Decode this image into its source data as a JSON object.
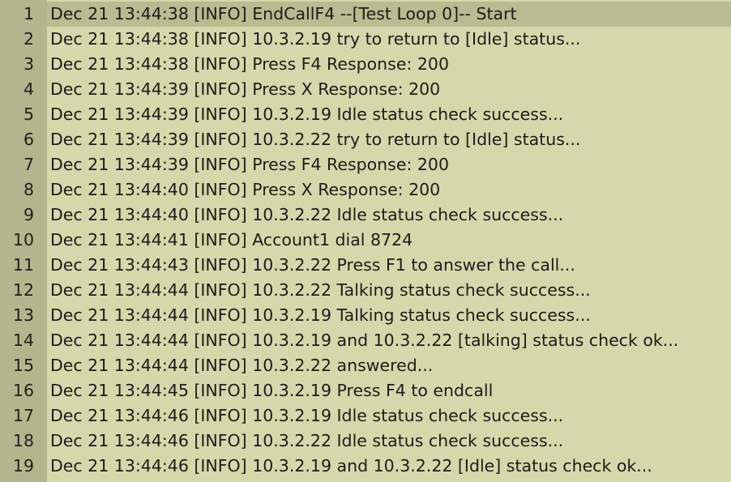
{
  "lines": [
    {
      "number": "1",
      "text": "Dec 21 13:44:38 [INFO] EndCallF4 --[Test Loop 0]-- Start"
    },
    {
      "number": "2",
      "text": "Dec 21 13:44:38 [INFO] 10.3.2.19 try to return to [Idle] status..."
    },
    {
      "number": "3",
      "text": "Dec 21 13:44:38 [INFO] Press F4 Response: 200"
    },
    {
      "number": "4",
      "text": "Dec 21 13:44:39 [INFO] Press X Response: 200"
    },
    {
      "number": "5",
      "text": "Dec 21 13:44:39 [INFO] 10.3.2.19 Idle status check success..."
    },
    {
      "number": "6",
      "text": "Dec 21 13:44:39 [INFO] 10.3.2.22 try to return to [Idle] status..."
    },
    {
      "number": "7",
      "text": "Dec 21 13:44:39 [INFO] Press F4 Response: 200"
    },
    {
      "number": "8",
      "text": "Dec 21 13:44:40 [INFO] Press X Response: 200"
    },
    {
      "number": "9",
      "text": "Dec 21 13:44:40 [INFO] 10.3.2.22 Idle status check success..."
    },
    {
      "number": "10",
      "text": "Dec 21 13:44:41 [INFO] Account1 dial 8724"
    },
    {
      "number": "11",
      "text": "Dec 21 13:44:43 [INFO] 10.3.2.22 Press F1 to answer the call..."
    },
    {
      "number": "12",
      "text": "Dec 21 13:44:44 [INFO] 10.3.2.22 Talking status check success..."
    },
    {
      "number": "13",
      "text": "Dec 21 13:44:44 [INFO] 10.3.2.19 Talking status check success..."
    },
    {
      "number": "14",
      "text": "Dec 21 13:44:44 [INFO] 10.3.2.19 and 10.3.2.22 [talking] status check ok..."
    },
    {
      "number": "15",
      "text": "Dec 21 13:44:44 [INFO] 10.3.2.22 answered..."
    },
    {
      "number": "16",
      "text": "Dec 21 13:44:45 [INFO] 10.3.2.19 Press F4 to endcall"
    },
    {
      "number": "17",
      "text": "Dec 21 13:44:46 [INFO] 10.3.2.19 Idle status check success..."
    },
    {
      "number": "18",
      "text": "Dec 21 13:44:46 [INFO] 10.3.2.22 Idle status check success..."
    },
    {
      "number": "19",
      "text": "Dec 21 13:44:46 [INFO] 10.3.2.19 and 10.3.2.22 [Idle] status check ok..."
    }
  ],
  "colors": {
    "background": "#d5d8aa",
    "gutter": "#b4b58c",
    "current_line": "#b9bb90",
    "text": "#1c1c1c"
  }
}
